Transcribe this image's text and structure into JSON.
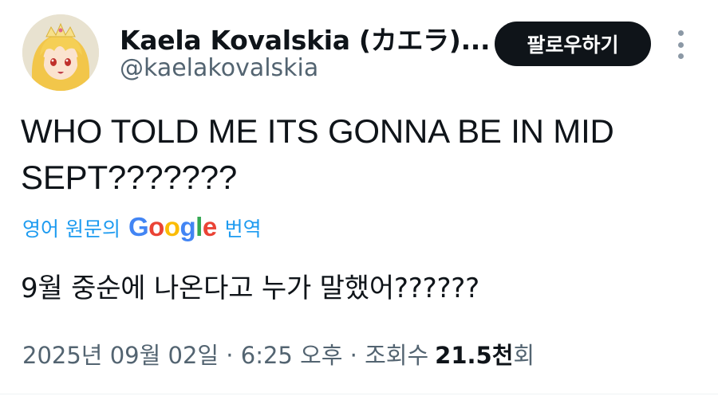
{
  "author": {
    "display_name": "Kaela Kovalskia (カエラ)...",
    "handle": "@kaelakovalskia"
  },
  "header": {
    "follow_label": "팔로우하기",
    "more_icon": "more-vertical-icon"
  },
  "tweet": {
    "text": "WHO TOLD ME ITS GONNA BE IN MID SEPT???????",
    "translate": {
      "prefix": "영어 원문의",
      "google": {
        "G": "G",
        "o1": "o",
        "o2": "o",
        "g": "g",
        "l": "l",
        "e": "e"
      },
      "suffix": "번역"
    },
    "translated_text": "9월 중순에 나온다고 누가 말했어??????"
  },
  "meta": {
    "date": "2025년 09월 02일",
    "sep1": " · ",
    "time": "6:25 오후",
    "sep2": " · ",
    "views_label": "조회수",
    "views_number": "21.5천",
    "views_unit": "회"
  },
  "colors": {
    "link": "#1d9bf0",
    "secondary_text": "#536471",
    "primary_text": "#0f1419",
    "button_bg": "#0f1419"
  }
}
